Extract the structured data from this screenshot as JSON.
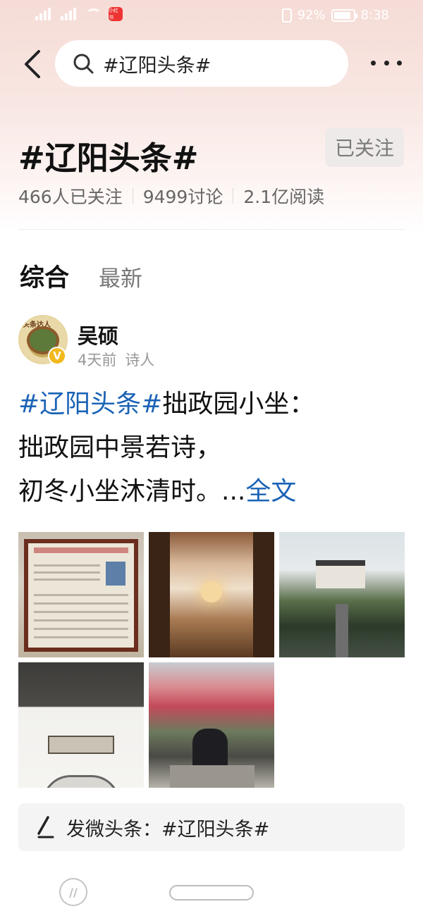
{
  "status_bar": {
    "app_badge": "小红书",
    "battery": "92%",
    "time": "8:38",
    "battery_level": 0.92
  },
  "search": {
    "query": "#辽阳头条#"
  },
  "topic": {
    "title": "#辽阳头条#",
    "follow_label": "已关注",
    "stats": [
      "466人已关注",
      "9499讨论",
      "2.1亿阅读"
    ]
  },
  "tabs": [
    {
      "label": "综合",
      "active": true
    },
    {
      "label": "最新",
      "active": false
    }
  ],
  "post": {
    "author": "吴硕",
    "time": "4天前",
    "role": "诗人",
    "verified_badge": "V",
    "avatar_text": "头条达人",
    "content": {
      "hashtag": "#辽阳头条#",
      "line1_rest": "拙政园小坐：",
      "line2": "拙政园中景若诗，",
      "line3": "初冬小坐沐清时。...",
      "full_link": "全文"
    },
    "images": [
      {
        "icon": "info-board-photo"
      },
      {
        "icon": "interior-window-photo"
      },
      {
        "icon": "pavilion-pond-photo"
      },
      {
        "icon": "corridor-plaque-photo"
      },
      {
        "icon": "man-sitting-garden-photo"
      }
    ]
  },
  "publish": {
    "label": "发微头条：#辽阳头条#"
  },
  "nav": {
    "logo_text": "//"
  },
  "colors": {
    "link": "#1a63b6",
    "verified": "#f3b81d",
    "header_gradient_top": "#f6dcd6"
  }
}
